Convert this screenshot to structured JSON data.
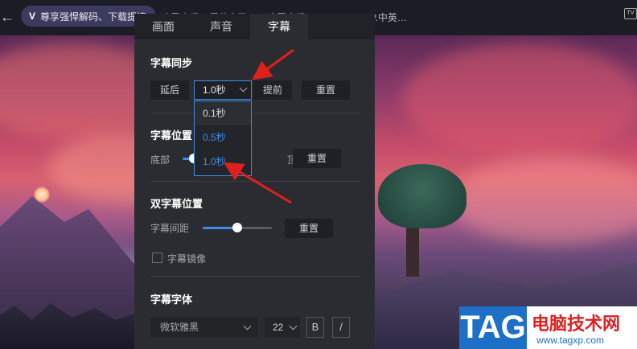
{
  "topbar": {
    "promo_mark": "V",
    "promo_text": "尊享强悍解码、下载提速",
    "title": "冰雪奇缘：爱莎之歌……冰雪奇缘.2022.BD.1080P.中英…",
    "tv_icon": "TV"
  },
  "panel": {
    "tabs": [
      "画面",
      "声音",
      "字幕"
    ],
    "active_tab": "字幕",
    "sync": {
      "title": "字幕同步",
      "delay_label": "延后",
      "selected": "1.0秒",
      "advance_label": "提前",
      "reset_label": "重置",
      "options": [
        "0.1秒",
        "0.5秒",
        "1.0秒"
      ]
    },
    "position": {
      "title": "字幕位置",
      "bottom_label": "底部",
      "top_label": "顶部",
      "reset_label": "重置"
    },
    "dual": {
      "title": "双字幕位置",
      "spacing_label": "字幕间距",
      "spacing_value": 0.5,
      "reset_label": "重置",
      "mirror_label": "字幕镜像",
      "mirror_checked": false
    },
    "font": {
      "title": "字幕字体",
      "family": "微软雅黑",
      "size": "22",
      "bold_label": "B",
      "italic_label": "/"
    }
  },
  "watermark": {
    "tag": "TAG",
    "name": "电脑技术网",
    "url": "www.tagxp.com"
  },
  "colors": {
    "accent": "#3a8ee6",
    "arrow": "#e0201c"
  }
}
